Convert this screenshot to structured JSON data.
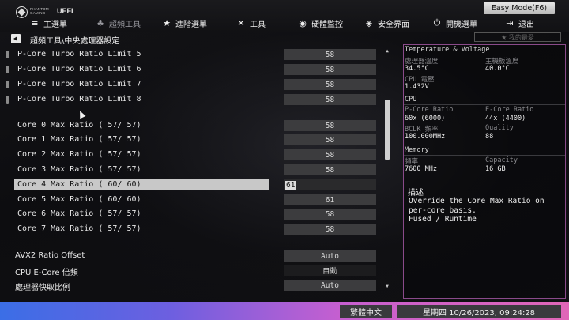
{
  "logo": {
    "brand_line1": "PHANTOM",
    "brand_line2": "GAMING",
    "uefi": "UEFI"
  },
  "nav": [
    {
      "label": "主選單",
      "icon": "≡",
      "active": false
    },
    {
      "label": "超頻工具",
      "icon": "♣",
      "active": true
    },
    {
      "label": "進階選單",
      "icon": "★",
      "active": false
    },
    {
      "label": "工具",
      "icon": "✕",
      "active": false
    },
    {
      "label": "硬體監控",
      "icon": "◉",
      "active": false
    },
    {
      "label": "安全界面",
      "icon": "◈",
      "active": false
    },
    {
      "label": "開機選單",
      "icon": "⏻",
      "active": false
    },
    {
      "label": "退出",
      "icon": "⇥",
      "active": false
    }
  ],
  "easy_mode_label": "Easy Mode(F6)",
  "breadcrumb": "超頻工具\\中央處理器設定",
  "favorites_label": "★ 我的最愛",
  "settings": [
    {
      "label": "P-Core Turbo Ratio Limit 5",
      "value": "58"
    },
    {
      "label": "P-Core Turbo Ratio Limit 6",
      "value": "58"
    },
    {
      "label": "P-Core Turbo Ratio Limit 7",
      "value": "58"
    },
    {
      "label": "P-Core Turbo Ratio Limit 8",
      "value": "58"
    },
    {
      "label": "Core 0 Max Ratio ( 57/ 57)",
      "value": "58"
    },
    {
      "label": "Core 1 Max Ratio ( 57/ 57)",
      "value": "58"
    },
    {
      "label": "Core 2 Max Ratio ( 57/ 57)",
      "value": "58"
    },
    {
      "label": "Core 3 Max Ratio ( 57/ 57)",
      "value": "58"
    },
    {
      "label": "Core 4 Max Ratio ( 60/ 60)",
      "value": "61"
    },
    {
      "label": "Core 5 Max Ratio ( 60/ 60)",
      "value": "61"
    },
    {
      "label": "Core 6 Max Ratio ( 57/ 57)",
      "value": "58"
    },
    {
      "label": "Core 7 Max Ratio ( 57/ 57)",
      "value": "58"
    },
    {
      "label": "AVX2 Ratio Offset",
      "value": "Auto"
    },
    {
      "label": "CPU E-Core 倍頻",
      "value": "自動"
    },
    {
      "label": "處理器快取比例",
      "value": "Auto"
    }
  ],
  "info_panel": {
    "temp_title": "Temperature & Voltage",
    "cpu_temp_label": "處理器溫度",
    "cpu_temp_value": "34.5°C",
    "mb_temp_label": "主機板溫度",
    "mb_temp_value": "40.0°C",
    "cpu_volt_label": "CPU 電壓",
    "cpu_volt_value": "1.432V",
    "cpu_title": "CPU",
    "pcore_label": "P-Core Ratio",
    "pcore_value": "60x (6000)",
    "ecore_label": "E-Core Ratio",
    "ecore_value": "44x (4400)",
    "bclk_label": "BCLK 頻率",
    "bclk_value": "100.000MHz",
    "quality_label": "Quality",
    "quality_value": "88",
    "mem_title": "Memory",
    "freq_label": "頻率",
    "freq_value": "7600 MHz",
    "cap_label": "Capacity",
    "cap_value": "16 GB",
    "desc_title": "描述",
    "desc_text": "Override the Core Max Ratio on\nper-core basis.\nFused / Runtime"
  },
  "bottom": {
    "language": "繁體中文",
    "datetime": "星期四 10/26/2023, 09:24:28"
  }
}
